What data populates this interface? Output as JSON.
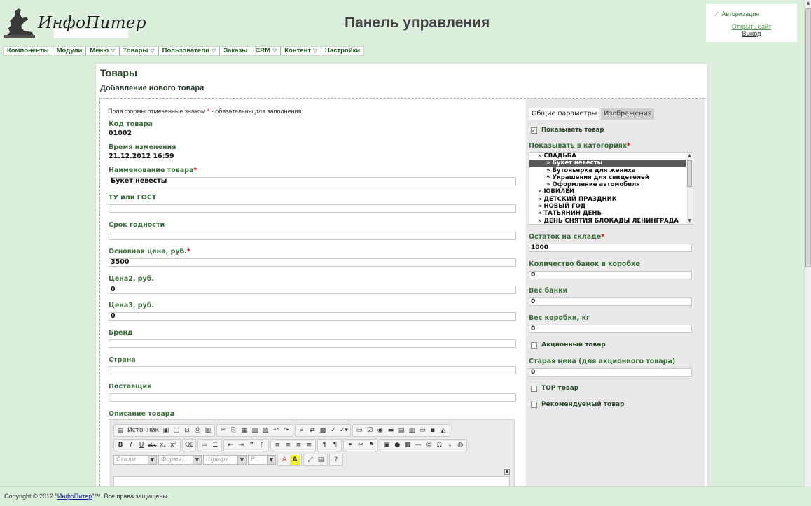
{
  "header": {
    "logo_text": "ИнфоПитер",
    "title": "Панель управления",
    "auth": {
      "title": "Авторизация",
      "open_site": "Открыть сайт",
      "logout": "Выход"
    }
  },
  "menu": {
    "items": [
      {
        "label": "Компоненты",
        "dropdown": false
      },
      {
        "label": "Модули",
        "dropdown": false
      },
      {
        "label": "Меню",
        "dropdown": true
      },
      {
        "label": "Товары",
        "dropdown": true
      },
      {
        "label": "Пользователи",
        "dropdown": true
      },
      {
        "label": "Заказы",
        "dropdown": false
      },
      {
        "label": "CRM",
        "dropdown": true
      },
      {
        "label": "Контент",
        "dropdown": true
      },
      {
        "label": "Настройки",
        "dropdown": false
      }
    ],
    "caret": "▽"
  },
  "page": {
    "title": "Товары",
    "subtitle": "Добавление нового товара",
    "note_before": "Поля формы отмеченные знаком",
    "note_star": "*",
    "note_after": "- обязательны для заполнения."
  },
  "form": {
    "code_label": "Код товара",
    "code_value": "01002",
    "modified_label": "Время изменения",
    "modified_value": "21.12.2012 16:59",
    "name_label": "Наименование товара",
    "name_value": "Букет невесты",
    "tu_label": "ТУ или ГОСТ",
    "tu_value": "",
    "shelf_label": "Срок годности",
    "shelf_value": "",
    "price_label": "Основная цена, руб.",
    "price_value": "3500",
    "price2_label": "Цена2, руб.",
    "price2_value": "0",
    "price3_label": "Цена3, руб.",
    "price3_value": "0",
    "brand_label": "Бренд",
    "brand_value": "",
    "country_label": "Страна",
    "country_value": "",
    "supplier_label": "Поставщик",
    "supplier_value": "",
    "description_label": "Описание товара",
    "required_mark": "*"
  },
  "editor": {
    "source_label": "Источник",
    "styles_placeholder": "Стили",
    "format_placeholder": "Форма...",
    "font_placeholder": "Шрифт",
    "size_placeholder": "Р...",
    "bold": "B",
    "italic": "I",
    "underline": "U",
    "strike": "abc",
    "subscript": "x₂",
    "superscript": "x²",
    "quote": "❞",
    "ltr": "¶",
    "text_color": "A",
    "bg_color": "A",
    "help": "?"
  },
  "side": {
    "tabs": [
      "Общие параметры",
      "Изображения"
    ],
    "show_product_label": "Показывать товар",
    "show_product_checked": true,
    "categories_label": "Показывать в категориях",
    "categories": [
      {
        "label": "» СВАДЬБА",
        "level": 1,
        "selected": false
      },
      {
        "label": "» Букет невесты",
        "level": 2,
        "selected": true
      },
      {
        "label": "» Бутоньерка для жениха",
        "level": 2,
        "selected": false
      },
      {
        "label": "» Украшения для свидетелей",
        "level": 2,
        "selected": false
      },
      {
        "label": "» Оформление автомобиля",
        "level": 2,
        "selected": false
      },
      {
        "label": "» ЮБИЛЕЙ",
        "level": 1,
        "selected": false
      },
      {
        "label": "» ДЕТСКИЙ ПРАЗДНИК",
        "level": 1,
        "selected": false
      },
      {
        "label": "» НОВЫЙ ГОД",
        "level": 1,
        "selected": false
      },
      {
        "label": "» ТАТЬЯНИН ДЕНЬ",
        "level": 1,
        "selected": false
      },
      {
        "label": "» ДЕНЬ СНЯТИЯ БЛОКАДЫ ЛЕНИНГРАДА",
        "level": 1,
        "selected": false
      }
    ],
    "stock_label": "Остаток на складе",
    "stock_value": "1000",
    "cans_label": "Количество банок в коробке",
    "cans_value": "0",
    "can_weight_label": "Вес банки",
    "can_weight_value": "0",
    "box_weight_label": "Вес коробки, кг",
    "box_weight_value": "0",
    "promo_label": "Акционный товар",
    "promo_checked": false,
    "old_price_label": "Старая цена (для акционного товара)",
    "old_price_value": "0",
    "top_label": "TOP товар",
    "top_checked": false,
    "recommended_label": "Рекомендуемый товар",
    "recommended_checked": false
  },
  "footer": {
    "before": "Copyright © 2012 \"",
    "link": "ИнфоПитер",
    "after": "\"™. Все права защищены."
  },
  "colors": {
    "background": "#dcefdc",
    "accent_green": "#3a6a3a",
    "required": "#dd0000"
  }
}
